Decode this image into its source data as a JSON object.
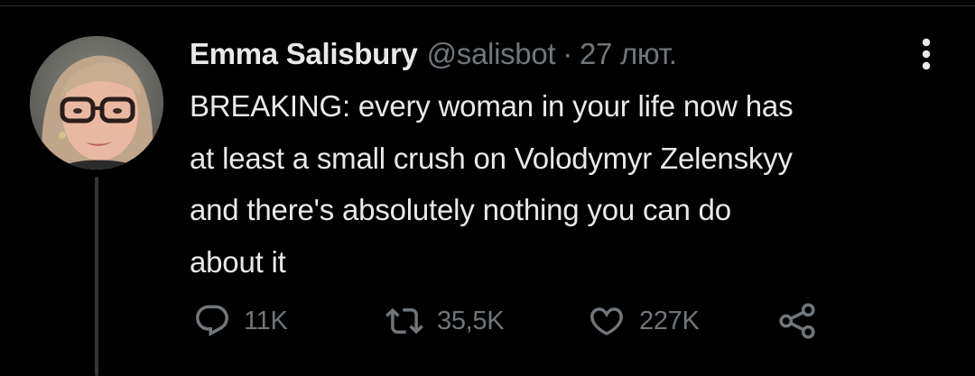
{
  "tweet": {
    "author": {
      "display_name": "Emma Salisbury",
      "handle": "@salisbot"
    },
    "separator": "·",
    "date": "27 лют.",
    "text": "BREAKING: every woman in your life now has\nat least a small crush on Volodymyr Zelenskyy\nand there's absolutely nothing you can do\nabout it",
    "actions": {
      "reply": {
        "icon": "reply-icon",
        "count": "11K"
      },
      "retweet": {
        "icon": "retweet-icon",
        "count": "35,5K"
      },
      "like": {
        "icon": "heart-icon",
        "count": "227K"
      },
      "share": {
        "icon": "share-icon"
      }
    }
  },
  "colors": {
    "background": "#000000",
    "primary_text": "#e7e9ea",
    "secondary_text": "#71767b",
    "thread_line": "#333639"
  }
}
